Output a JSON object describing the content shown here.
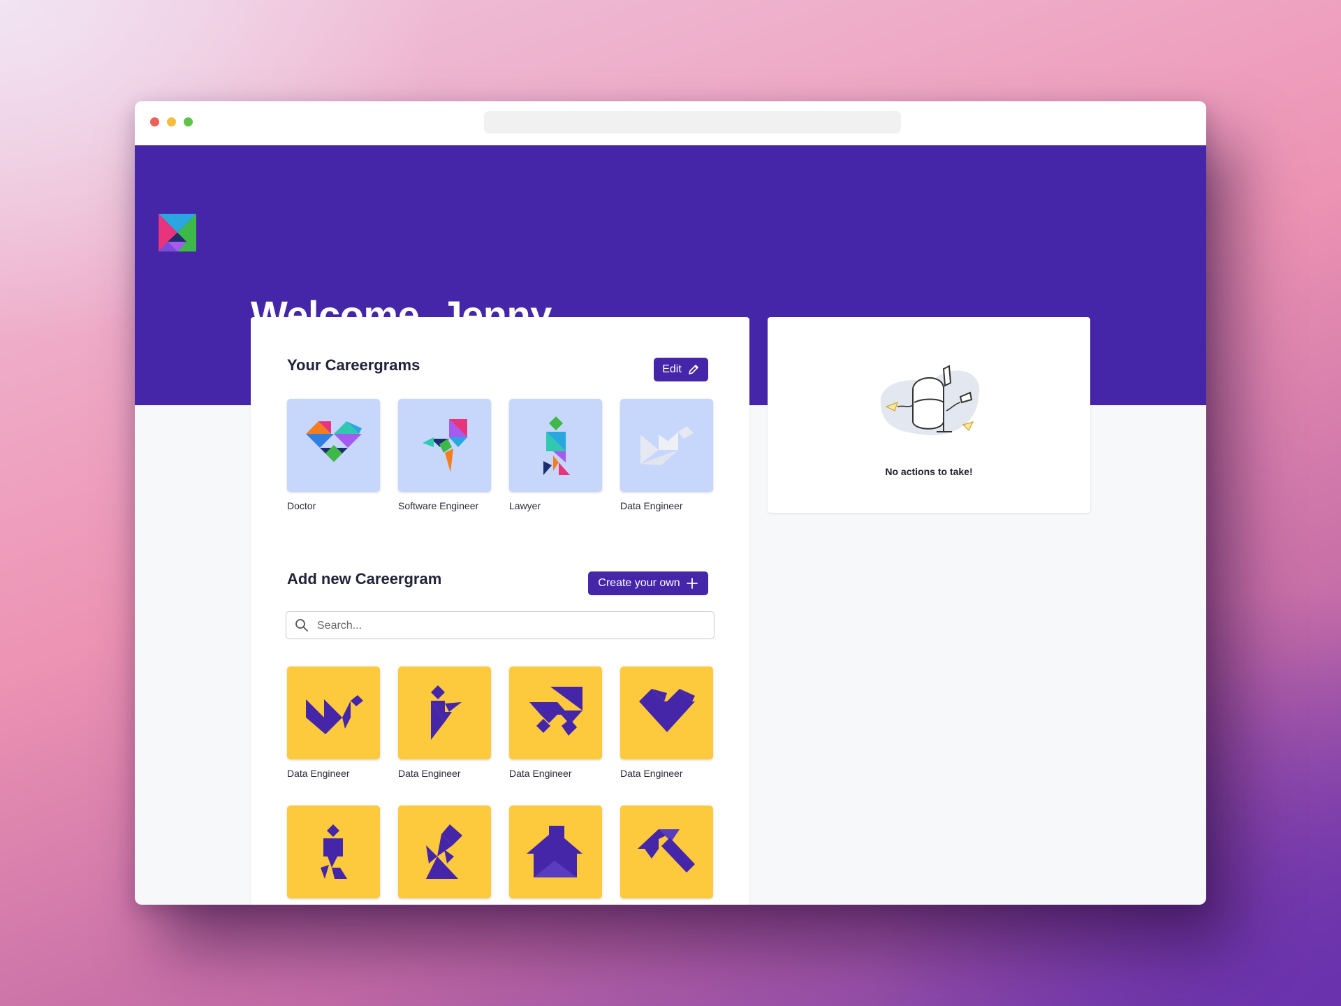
{
  "window": {
    "controls": [
      "close",
      "minimize",
      "maximize"
    ]
  },
  "header": {
    "logo_icon": "tangram-logo-icon",
    "welcome": "Welcome, Jenny."
  },
  "careergrams": {
    "title": "Your Careergrams",
    "edit_label": "Edit",
    "edit_icon": "pencil-icon",
    "items": [
      {
        "label": "Doctor",
        "icon": "tangram-heart-icon"
      },
      {
        "label": "Software Engineer",
        "icon": "tangram-bird-icon"
      },
      {
        "label": "Lawyer",
        "icon": "tangram-person-icon"
      },
      {
        "label": "Data Engineer",
        "icon": "tangram-swan-icon"
      }
    ]
  },
  "add_new": {
    "title": "Add new Careergram",
    "create_label": "Create your own",
    "create_icon": "plus-icon",
    "search_placeholder": "Search...",
    "search_icon": "search-icon",
    "items": [
      {
        "label": "Data Engineer",
        "icon": "tangram-swan-icon"
      },
      {
        "label": "Data Engineer",
        "icon": "tangram-figure-icon"
      },
      {
        "label": "Data Engineer",
        "icon": "tangram-cat-icon"
      },
      {
        "label": "Data Engineer",
        "icon": "tangram-heart-icon"
      },
      {
        "icon": "tangram-walker-icon"
      },
      {
        "icon": "tangram-kneel-icon"
      },
      {
        "icon": "tangram-house-icon"
      },
      {
        "icon": "tangram-hammer-icon"
      }
    ]
  },
  "actions": {
    "illustration": "empty-mailbox-illustration",
    "message": "No actions to take!"
  },
  "colors": {
    "brand_purple": "#4525a8",
    "tile_blue": "#c6d7fb",
    "tile_yellow": "#fdc93d"
  }
}
